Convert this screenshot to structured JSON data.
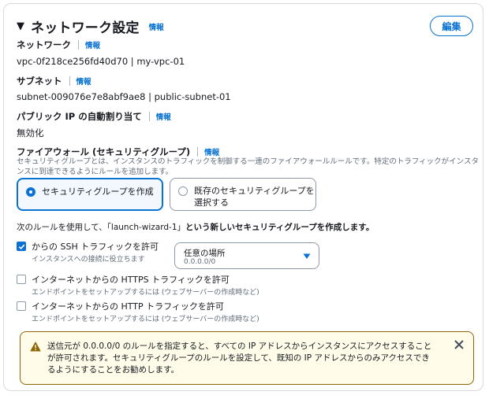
{
  "header": {
    "title": "ネットワーク設定",
    "info_link": "情報",
    "edit_label": "編集"
  },
  "network": {
    "label": "ネットワーク",
    "info_link": "情報",
    "value": "vpc-0f218ce256fd40d70 | my-vpc-01"
  },
  "subnet": {
    "label": "サブネット",
    "info_link": "情報",
    "value": "subnet-009076e7e8abf9ae8 | public-subnet-01"
  },
  "public_ip": {
    "label": "パブリック IP の自動割り当て",
    "info_link": "情報",
    "value": "無効化"
  },
  "firewall": {
    "label": "ファイアウォール (セキュリティグループ)",
    "info_link": "情報",
    "description": "セキュリティグループとは、インスタンスのトラフィックを制御する一連のファイアウォールルールです。特定のトラフィックがインスタンスに到達できるようにルールを追加します。",
    "options": [
      {
        "label": "セキュリティグループを作成",
        "selected": true
      },
      {
        "label_line1": "既存のセキュリティグループを",
        "label_line2": "選択する",
        "selected": false
      }
    ]
  },
  "rules": {
    "intro_normal": "次のルールを使用して、「launch-wizard-1」",
    "intro_bold": "という新しいセキュリティグループを作成します。",
    "items": [
      {
        "label": "からの SSH トラフィックを許可",
        "desc": "インスタンスへの接続に役立ちます",
        "checked": true
      },
      {
        "label": "インターネットからの HTTPS トラフィックを許可",
        "desc": "エンドポイントをセットアップするには (ウェブサーバーの作成時など)",
        "checked": false
      },
      {
        "label": "インターネットからの HTTP トラフィックを許可",
        "desc": "エンドポイントをセットアップするには (ウェブサーバーの作成時など)",
        "checked": false
      }
    ],
    "ssh_source": {
      "value": "任意の場所",
      "sub": "0.0.0.0/0"
    }
  },
  "alert": {
    "message": "送信元が 0.0.0.0/0 のルールを指定すると、すべての IP アドレスからインスタンスにアクセスすることが許可されます。セキュリティグループのルールを設定して、既知の IP アドレスからのみアクセスできるようにすることをお勧めします。",
    "icons": {
      "warning": "warning-icon",
      "close": "close-icon"
    }
  },
  "colors": {
    "accent": "#0972d3",
    "warning_border": "#8d6605",
    "warning_bg": "#fffce9"
  }
}
